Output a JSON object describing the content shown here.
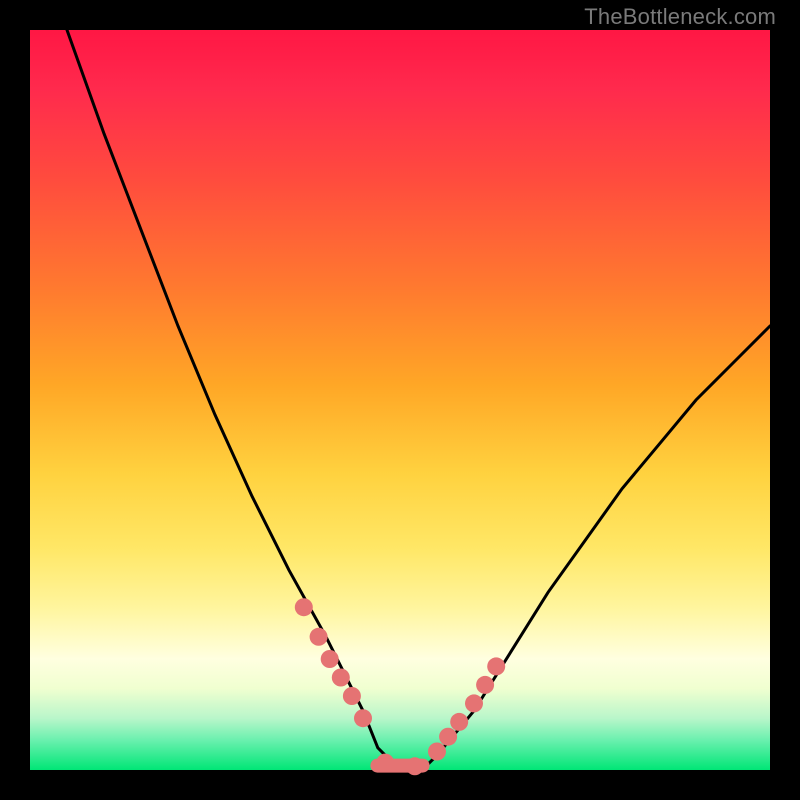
{
  "watermark": "TheBottleneck.com",
  "chart_data": {
    "type": "line",
    "title": "",
    "xlabel": "",
    "ylabel": "",
    "xlim": [
      0,
      100
    ],
    "ylim": [
      0,
      100
    ],
    "series": [
      {
        "name": "bottleneck-curve",
        "x": [
          5,
          10,
          15,
          20,
          25,
          30,
          35,
          40,
          45,
          47,
          50,
          53,
          55,
          60,
          65,
          70,
          75,
          80,
          85,
          90,
          95,
          100
        ],
        "values": [
          100,
          86,
          73,
          60,
          48,
          37,
          27,
          18,
          8,
          3,
          0,
          0,
          2,
          8,
          16,
          24,
          31,
          38,
          44,
          50,
          55,
          60
        ]
      }
    ],
    "markers": {
      "name": "highlight-points",
      "color": "#e57373",
      "x": [
        37,
        39,
        40.5,
        42,
        43.5,
        45,
        48,
        52,
        55,
        56.5,
        58,
        60,
        61.5,
        63
      ],
      "values": [
        22,
        18,
        15,
        12.5,
        10,
        7,
        1,
        0.5,
        2.5,
        4.5,
        6.5,
        9,
        11.5,
        14
      ]
    },
    "flat_segment": {
      "name": "trough-bar",
      "color": "#e57373",
      "x_start": 46,
      "x_end": 54,
      "y": 0.6
    }
  }
}
